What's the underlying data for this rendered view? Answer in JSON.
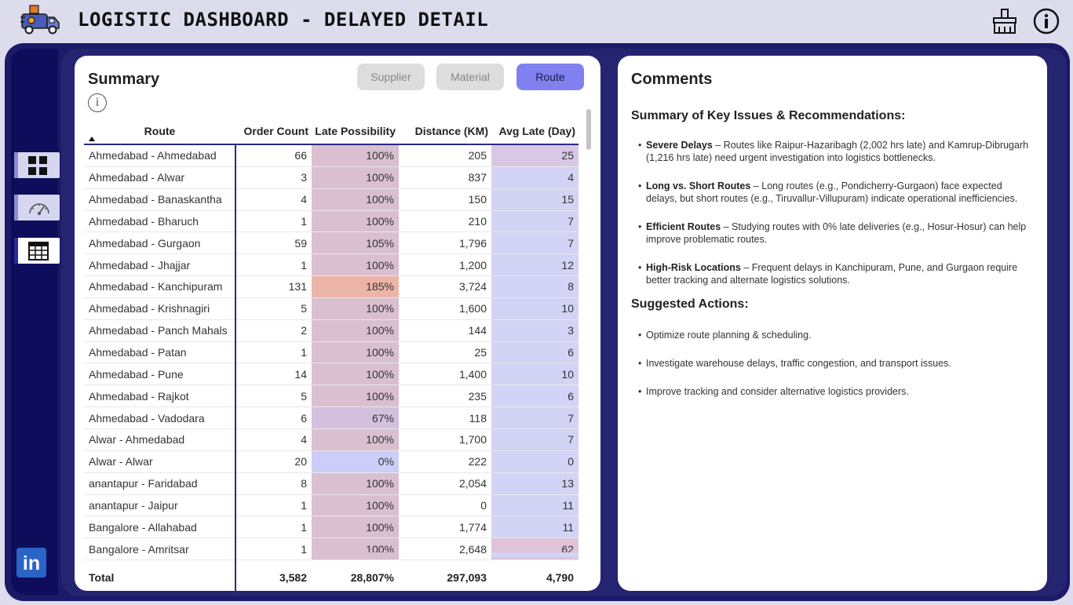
{
  "header": {
    "title": "LOGISTIC DASHBOARD - DELAYED DETAIL"
  },
  "icons": {
    "logo": "delivery-truck-logo",
    "clear_filters": "broom-icon",
    "info": "info-icon",
    "nav": [
      "dashboard-grid-icon",
      "speedometer-icon",
      "table-icon"
    ],
    "social": "linkedin-icon"
  },
  "sidebar": {
    "linkedin_label": "in"
  },
  "summary": {
    "title": "Summary",
    "info_glyph": "i",
    "tabs": [
      {
        "label": "Supplier",
        "active": false
      },
      {
        "label": "Material",
        "active": false
      },
      {
        "label": "Route",
        "active": true
      }
    ],
    "columns": [
      "Route",
      "Order Count",
      "Late Possibility",
      "Distance (KM)",
      "Avg Late (Day)"
    ],
    "rows": [
      [
        "Ahmedabad - Ahmedabad",
        "66",
        "100%",
        "205",
        "25"
      ],
      [
        "Ahmedabad - Alwar",
        "3",
        "100%",
        "837",
        "4"
      ],
      [
        "Ahmedabad - Banaskantha",
        "4",
        "100%",
        "150",
        "15"
      ],
      [
        "Ahmedabad - Bharuch",
        "1",
        "100%",
        "210",
        "7"
      ],
      [
        "Ahmedabad - Gurgaon",
        "59",
        "105%",
        "1,796",
        "7"
      ],
      [
        "Ahmedabad - Jhajjar",
        "1",
        "100%",
        "1,200",
        "12"
      ],
      [
        "Ahmedabad - Kanchipuram",
        "131",
        "185%",
        "3,724",
        "8"
      ],
      [
        "Ahmedabad - Krishnagiri",
        "5",
        "100%",
        "1,600",
        "10"
      ],
      [
        "Ahmedabad - Panch Mahals",
        "2",
        "100%",
        "144",
        "3"
      ],
      [
        "Ahmedabad - Patan",
        "1",
        "100%",
        "25",
        "6"
      ],
      [
        "Ahmedabad - Pune",
        "14",
        "100%",
        "1,400",
        "10"
      ],
      [
        "Ahmedabad - Rajkot",
        "5",
        "100%",
        "235",
        "6"
      ],
      [
        "Ahmedabad - Vadodara",
        "6",
        "67%",
        "118",
        "7"
      ],
      [
        "Alwar - Ahmedabad",
        "4",
        "100%",
        "1,700",
        "7"
      ],
      [
        "Alwar - Alwar",
        "20",
        "0%",
        "222",
        "0"
      ],
      [
        "anantapur - Faridabad",
        "8",
        "100%",
        "2,054",
        "13"
      ],
      [
        "anantapur - Jaipur",
        "1",
        "100%",
        "0",
        "11"
      ],
      [
        "Bangalore - Allahabad",
        "1",
        "100%",
        "1,774",
        "11"
      ],
      [
        "Bangalore - Amritsar",
        "1",
        "100%",
        "2,648",
        "62"
      ]
    ],
    "late_colors": {
      "Ahmedabad - Kanchipuram": "#ecb4a6",
      "Ahmedabad - Vadodara": "#d3c0de",
      "Alwar - Alwar": "#cdcdfa"
    },
    "avg_colors": {
      "Ahmedabad - Ahmedabad": "#d8c8e6",
      "Bangalore - Amritsar": "#dfc3d8"
    },
    "total": [
      "Total",
      "3,582",
      "28,807%",
      "297,093",
      "4,790"
    ]
  },
  "comments": {
    "title": "Comments",
    "key_issues_heading": "Summary of Key Issues & Recommendations:",
    "issues": [
      {
        "label": "Severe Delays",
        "text": " – Routes like Raipur-Hazaribagh (2,002 hrs late) and Kamrup-Dibrugarh (1,216 hrs late) need urgent investigation into logistics bottlenecks."
      },
      {
        "label": "Long vs. Short Routes",
        "text": " – Long routes (e.g., Pondicherry-Gurgaon) face expected delays, but short routes (e.g., Tiruvallur-Villupuram) indicate operational inefficiencies."
      },
      {
        "label": "Efficient Routes",
        "text": " – Studying routes with 0% late deliveries (e.g., Hosur-Hosur) can help improve problematic routes."
      },
      {
        "label": "High-Risk Locations",
        "text": " – Frequent delays in Kanchipuram, Pune, and Gurgaon require better tracking and alternate logistics solutions."
      }
    ],
    "actions_heading": "Suggested Actions:",
    "actions": [
      "Optimize route planning & scheduling.",
      "Investigate warehouse delays, traffic congestion, and transport issues.",
      "Improve tracking and consider alternative logistics providers."
    ]
  }
}
